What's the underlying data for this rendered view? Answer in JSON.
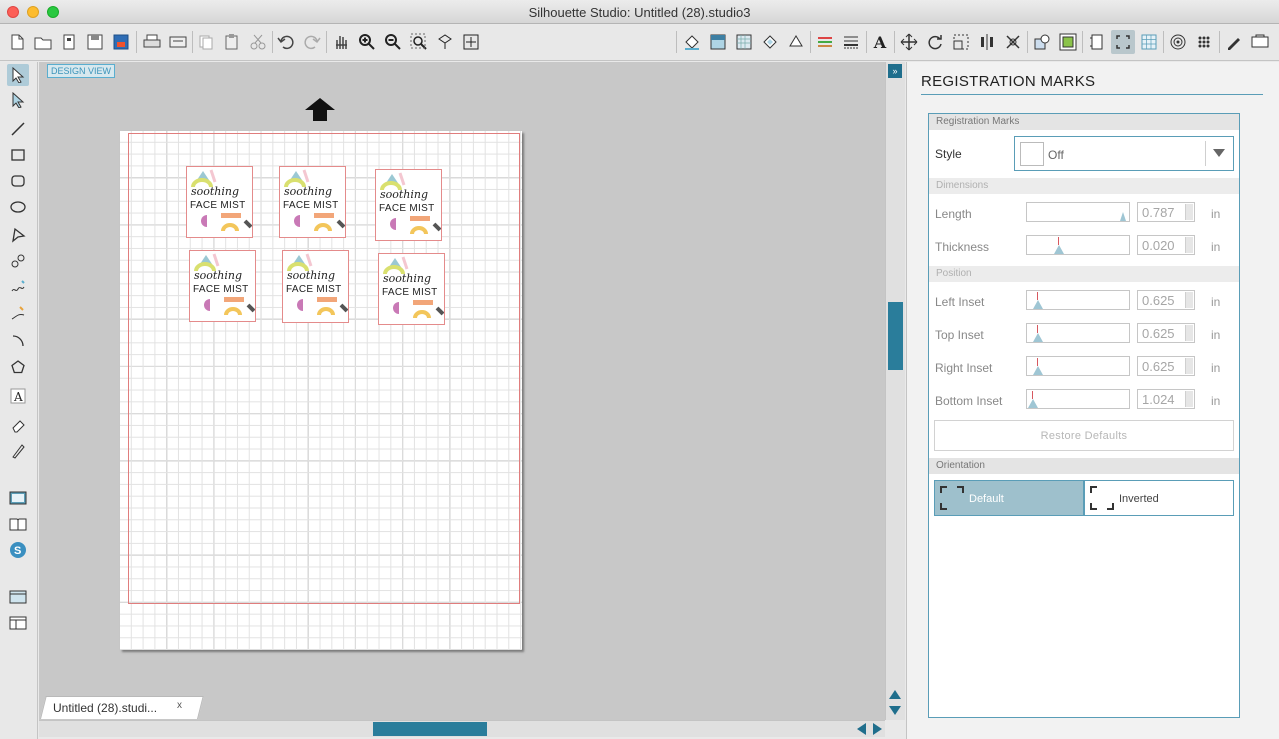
{
  "window": {
    "title": "Silhouette Studio: Untitled (28).studio3"
  },
  "toolbar": {
    "left_icons": [
      "new-icon",
      "open-icon",
      "new-page-icon",
      "save-icon",
      "save-library-icon",
      "print-icon",
      "print-cut-icon",
      "copy-icon",
      "paste-icon",
      "cut-icon",
      "undo-icon",
      "redo-icon",
      "hand-pan-icon",
      "zoom-in-icon",
      "zoom-out-icon",
      "zoom-select-icon",
      "zoom-drag-icon",
      "fit-page-icon"
    ],
    "right_icons": [
      "fill-color-icon",
      "gradient-icon",
      "fill-pattern-icon",
      "fill-library-icon",
      "line-color-icon",
      "line-style-icon",
      "line-weight-icon",
      "text-style-icon",
      "transform-icon",
      "rotate-icon",
      "scale-icon",
      "align-icon",
      "replicate-icon",
      "modify-icon",
      "offset-icon",
      "trace-icon",
      "page-setup-icon",
      "registration-marks-icon",
      "grid-settings-icon",
      "cut-settings-icon",
      "dots-icon",
      "send-cut-icon",
      "silhouette-store-icon"
    ]
  },
  "canvas": {
    "design_view_label": "DESIGN VIEW"
  },
  "labels": [
    {
      "line1": "soothing",
      "line2": "FACE MIST"
    },
    {
      "line1": "soothing",
      "line2": "FACE MIST"
    },
    {
      "line1": "soothing",
      "line2": "FACE MIST"
    },
    {
      "line1": "soothing",
      "line2": "FACE MIST"
    },
    {
      "line1": "soothing",
      "line2": "FACE MIST"
    },
    {
      "line1": "soothing",
      "line2": "FACE MIST"
    }
  ],
  "doc_tab": {
    "label": "Untitled (28).studi...",
    "close": "x"
  },
  "panel": {
    "title": "REGISTRATION MARKS",
    "section_registration": "Registration Marks",
    "style_label": "Style",
    "style_value": "Off",
    "section_dimensions": "Dimensions",
    "length": {
      "label": "Length",
      "value": "0.787",
      "unit": "in"
    },
    "thickness": {
      "label": "Thickness",
      "value": "0.020",
      "unit": "in"
    },
    "section_position": "Position",
    "left_inset": {
      "label": "Left Inset",
      "value": "0.625",
      "unit": "in"
    },
    "top_inset": {
      "label": "Top Inset",
      "value": "0.625",
      "unit": "in"
    },
    "right_inset": {
      "label": "Right Inset",
      "value": "0.625",
      "unit": "in"
    },
    "bottom_inset": {
      "label": "Bottom Inset",
      "value": "1.024",
      "unit": "in"
    },
    "restore_label": "Restore Defaults",
    "section_orientation": "Orientation",
    "orientation_default": "Default",
    "orientation_inverted": "Inverted"
  },
  "colors": {
    "accent": "#5a9db7",
    "mat_border": "#e07d7d",
    "selected_orient": "#9ec0cc"
  }
}
